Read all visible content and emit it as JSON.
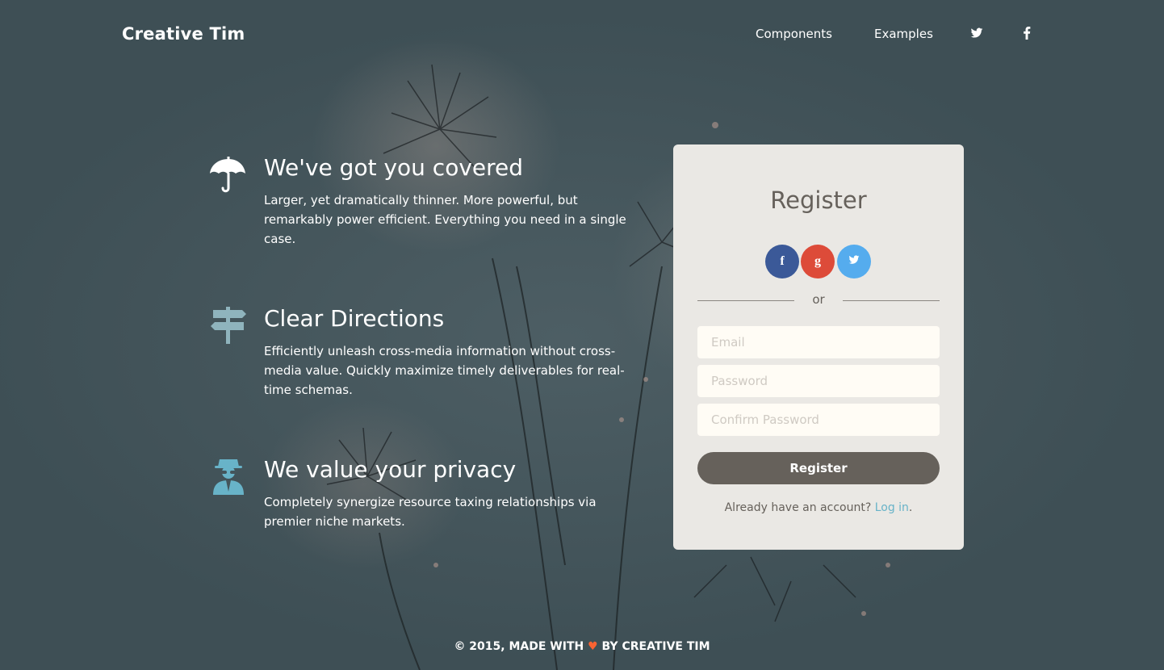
{
  "nav": {
    "brand": "Creative Tim",
    "links": [
      "Components",
      "Examples"
    ],
    "icons": [
      "twitter-icon",
      "facebook-icon"
    ]
  },
  "features": [
    {
      "icon": "umbrella-icon",
      "title": "We've got you covered",
      "text": "Larger, yet dramatically thinner. More powerful, but remarkably power efficient. Everything you need in a single case."
    },
    {
      "icon": "signpost-icon",
      "title": "Clear Directions",
      "text": "Efficiently unleash cross-media information without cross-media value. Quickly maximize timely deliverables for real-time schemas."
    },
    {
      "icon": "spy-icon",
      "title": "We value your privacy",
      "text": "Completely synergize resource taxing relationships via premier niche markets."
    }
  ],
  "register": {
    "title": "Register",
    "social": [
      {
        "icon": "facebook-icon",
        "glyph": "f",
        "color": "#3b5998"
      },
      {
        "icon": "google-plus-icon",
        "glyph": "g",
        "color": "#dd4b39"
      },
      {
        "icon": "twitter-icon",
        "glyph": "t",
        "color": "#55acee"
      }
    ],
    "divider": "or",
    "email_placeholder": "Email",
    "password_placeholder": "Password",
    "confirm_placeholder": "Confirm Password",
    "button": "Register",
    "login_prompt": "Already have an account?",
    "login_link": "Log in",
    "login_suffix": "."
  },
  "footer": {
    "prefix": "© 2015, MADE WITH",
    "heart": "♥",
    "suffix": "BY CREATIVE TIM"
  },
  "colors": {
    "accent": "#68b3c8",
    "heart": "#f96332",
    "card": "#eae8e4",
    "button": "#66615b"
  }
}
